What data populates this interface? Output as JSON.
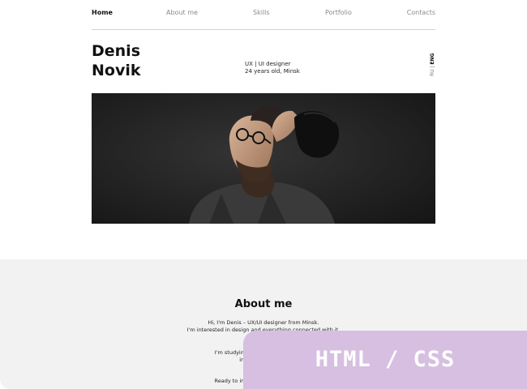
{
  "nav": {
    "items": [
      {
        "label": "Home",
        "active": true
      },
      {
        "label": "About me",
        "active": false
      },
      {
        "label": "Skills",
        "active": false
      },
      {
        "label": "Portfolio",
        "active": false
      },
      {
        "label": "Contacts",
        "active": false
      }
    ]
  },
  "hero": {
    "name_first": "Denis",
    "name_last": "Novik",
    "role": "UX | UI designer",
    "info": "24 years old, Minsk",
    "lang": {
      "eng": "ENG",
      "sep": " | ",
      "ru": "RU"
    }
  },
  "about": {
    "title": "About me",
    "lines": [
      "Hi, I'm Denis – UX/UI designer from Minsk.",
      "I'm interested in design and everything connected with it.",
      "I'm studying at co",
      "interfa",
      "Ready to im"
    ]
  },
  "badge": {
    "label": "HTML / CSS"
  },
  "colors": {
    "accent": "#d6bfe0",
    "section_bg": "#f2f2f2",
    "photo_bg": "#262626"
  }
}
